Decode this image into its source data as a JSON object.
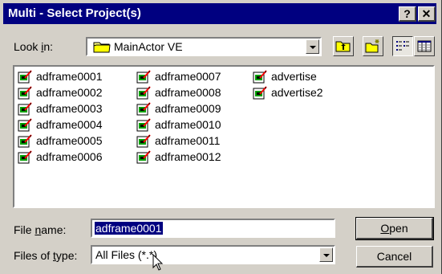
{
  "title": "Multi - Select Project(s)",
  "title_buttons": {
    "help": "?",
    "close": "✕"
  },
  "look_in": {
    "label_pre": "Look ",
    "label_key": "i",
    "label_post": "n:",
    "folder": "MainActor VE"
  },
  "toolbar": {
    "up": "up-folder-icon",
    "new_folder": "new-folder-icon",
    "list": "list-view-icon",
    "details": "details-view-icon"
  },
  "files": [
    [
      "adframe0001",
      "adframe0002",
      "adframe0003",
      "adframe0004",
      "adframe0005",
      "adframe0006"
    ],
    [
      "adframe0007",
      "adframe0008",
      "adframe0009",
      "adframe0010",
      "adframe0011",
      "adframe0012"
    ],
    [
      "advertise",
      "advertise2"
    ]
  ],
  "file_name": {
    "label_pre": "File ",
    "label_key": "n",
    "label_post": "ame:",
    "value": "adframe0001"
  },
  "file_type": {
    "label_pre": "Files of ",
    "label_key": "t",
    "label_post": "ype:",
    "value": "All Files (*.*)"
  },
  "buttons": {
    "open_key": "O",
    "open_rest": "pen",
    "cancel": "Cancel"
  },
  "colors": {
    "titlebar": "#000080",
    "face": "#d4d0c8",
    "selection": "#000080"
  }
}
